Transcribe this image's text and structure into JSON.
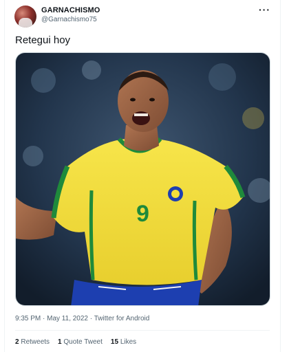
{
  "tweet": {
    "display_name": "GARNACHISMO",
    "handle": "@Garnachismo75",
    "more_icon": "more-horizontal-icon",
    "text": "Retegui hoy",
    "jersey_number": "9",
    "meta": {
      "time": "9:35 PM",
      "sep1": " · ",
      "date": "May 11, 2022",
      "sep2": " · ",
      "source": "Twitter for Android"
    },
    "stats": {
      "retweets_count": "2",
      "retweets_label": "Retweets",
      "quotes_count": "1",
      "quotes_label": "Quote Tweet",
      "likes_count": "15",
      "likes_label": "Likes"
    }
  },
  "colors": {
    "text_primary": "#0f1419",
    "text_secondary": "#536471",
    "divider": "#eff3f4",
    "jersey_yellow": "#f3de3a",
    "jersey_green": "#1f8a3b",
    "shorts_blue": "#1d3fb0"
  }
}
